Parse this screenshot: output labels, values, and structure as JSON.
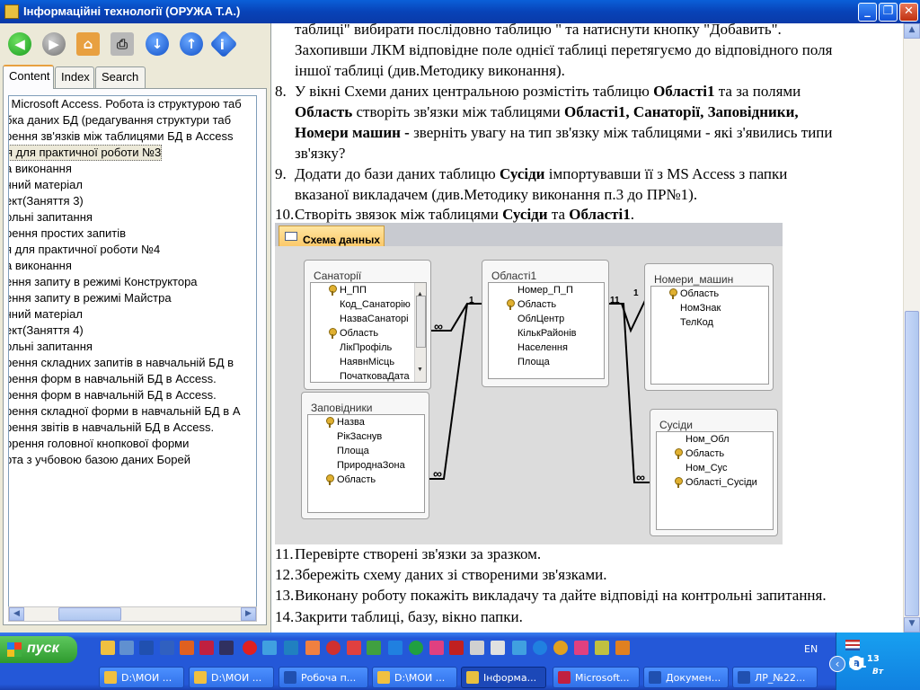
{
  "window": {
    "title": "Інформаційні технології (ОРУЖА Т.А.)"
  },
  "window_controls": [
    "_",
    "❐",
    "✕"
  ],
  "toolbar": [
    "back",
    "forward",
    "home",
    "print",
    "down",
    "up",
    "info"
  ],
  "nav_tabs": [
    "Content",
    "Index",
    "Search"
  ],
  "toc": [
    "l Microsoft Access. Робота із структурою таб",
    "бка даних БД (редагування структури таб",
    "рення зв'язків між таблицями БД в Access",
    "я для практичної роботи №3",
    "а виконання",
    "чний матеріал",
    "ект(Заняття 3)",
    "ольні запитання",
    "рення простих запитів",
    "я для практичної роботи №4",
    "а виконання",
    "ення запиту в режимі Конструктора",
    "ення запиту в режимі Майстра",
    "чний матеріал",
    "ект(Заняття 4)",
    "ольні запитання",
    "рення складних запитів в навчальній БД в",
    "рення форм в навчальній БД в Access.",
    "рення форм в навчальній БД в Access.",
    "рення складної форми в навчальній БД в А",
    "рення звітів в навчальній БД в Access.",
    "орення головної кнопкової форми",
    "ота з учбовою базою даних Борей"
  ],
  "content": {
    "top_line": "таблиці\" вибирати послідовно таблицю \" та натиснути кнопку \"Добавить\".",
    "top_line2": "Захопивши ЛКМ відповідне поле однієї таблиці перетягуємо до відповідного поля",
    "top_line3": "іншої таблиці (див.Методику виконання).",
    "step8": {
      "num": "8.",
      "t1": "У вікні Схеми даних центральною розмістіть таблицю ",
      "b1": "Області1",
      "t2": " та за полями",
      "b2": "Область",
      "t3": " створіть зв'язки між таблицями ",
      "b3": "Області1, Санаторії, Заповідники,",
      "b4": "Номери машин -",
      "t4": " зверніть увагу на тип зв'язку між таблицями - які з'явились типи",
      "t5": "зв'язку?"
    },
    "step9": {
      "num": "9.",
      "t1": "Додати до бази даних таблицю ",
      "b1": "Сусіди",
      "t2": " імпортувавши її з MS Access з папки",
      "t3": "вказаної викладачем (див.Методику виконання п.3 до ПР№1)."
    },
    "step10": {
      "num": "10.",
      "t1": "Створіть звязок між таблицями ",
      "b1": "Сусіди",
      "t2": " та ",
      "b2": "Області1",
      "t3": "."
    },
    "step11": {
      "num": "11.",
      "t1": "Перевірте створені зв'язки за зразком."
    },
    "step12": {
      "num": "12.",
      "t1": "Збережіть схему даних зі створеними зв'язками."
    },
    "step13": {
      "num": "13.",
      "t1": "Виконану роботу покажіть викладачу та дайте відповіді на контрольні запитання."
    },
    "step14": {
      "num": "14.",
      "t1": "Закрити таблиці, базу, вікно папки."
    }
  },
  "diagram": {
    "tab_label": "Схема данных",
    "tables": [
      {
        "name": "Санаторії",
        "fields": [
          {
            "n": "Н_ПП",
            "key": true
          },
          {
            "n": "Код_Санаторію",
            "key": false
          },
          {
            "n": "НазваСанаторі",
            "key": false
          },
          {
            "n": "Область",
            "key": true
          },
          {
            "n": "ЛікПрофіль",
            "key": false
          },
          {
            "n": "НаявнМісць",
            "key": false
          },
          {
            "n": "ПочатковаДата",
            "key": false
          }
        ]
      },
      {
        "name": "Області1",
        "fields": [
          {
            "n": "Номер_П_П",
            "key": false
          },
          {
            "n": "Область",
            "key": true
          },
          {
            "n": "ОблЦентр",
            "key": false
          },
          {
            "n": "КількРайонів",
            "key": false
          },
          {
            "n": "Населення",
            "key": false
          },
          {
            "n": "Площа",
            "key": false
          }
        ]
      },
      {
        "name": "Номери_машин",
        "fields": [
          {
            "n": "Область",
            "key": true
          },
          {
            "n": "НомЗнак",
            "key": false
          },
          {
            "n": "ТелКод",
            "key": false
          }
        ]
      },
      {
        "name": "Заповідники",
        "fields": [
          {
            "n": "Назва",
            "key": true
          },
          {
            "n": "РікЗаснув",
            "key": false
          },
          {
            "n": "Площа",
            "key": false
          },
          {
            "n": "ПрироднаЗона",
            "key": false
          },
          {
            "n": "Область",
            "key": true
          }
        ]
      },
      {
        "name": "Сусіди",
        "fields": [
          {
            "n": "Ном_Обл",
            "key": false
          },
          {
            "n": "Область",
            "key": true
          },
          {
            "n": "Ном_Сус",
            "key": false
          },
          {
            "n": "Області_Сусіди",
            "key": true
          }
        ]
      }
    ],
    "labels": {
      "one": "1",
      "many": "∞",
      "one_one": "11"
    }
  },
  "taskbar": {
    "start_label": "пуск",
    "lang": "EN",
    "clock": "11",
    "clock_sup": "13",
    "clock_sub": "Вт",
    "tasks": [
      "D:\\МОИ ...",
      "D:\\МОИ ...",
      "Робоча п...",
      "D:\\МОИ ...",
      "Інформа...",
      "Microsoft...",
      "Докумен...",
      "ЛР_№22..."
    ]
  }
}
